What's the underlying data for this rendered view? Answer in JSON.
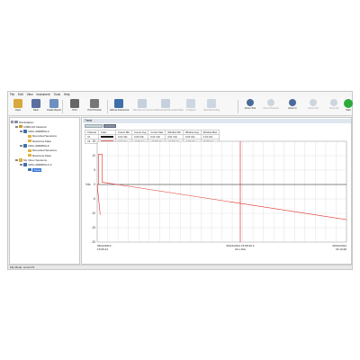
{
  "menu": [
    "File",
    "Edit",
    "View",
    "Instrument",
    "Tools",
    "Help"
  ],
  "toolbar": [
    {
      "label": "Open",
      "icon": "folder-icon",
      "color": "#d9a93b",
      "enabled": true
    },
    {
      "label": "Save",
      "icon": "save-icon",
      "color": "#5a6fa0",
      "enabled": true
    },
    {
      "label": "Create Report",
      "icon": "report-icon",
      "color": "#6e8fbf",
      "enabled": true
    },
    {
      "label": "Print",
      "icon": "print-icon",
      "color": "#666666",
      "enabled": true
    },
    {
      "label": "Print Preview",
      "icon": "print-preview-icon",
      "color": "#777777",
      "enabled": true
    },
    {
      "label": "Add an Instrument",
      "icon": "add-instrument-icon",
      "color": "#3f6fa8",
      "enabled": true
    },
    {
      "label": "Remove an Instrument",
      "icon": "remove-instrument-icon",
      "color": "#8aa0bd",
      "enabled": false
    },
    {
      "label": "Download Recorded Data",
      "icon": "download-icon",
      "color": "#8aa0bd",
      "enabled": false
    },
    {
      "label": "Configure",
      "icon": "configure-icon",
      "color": "#9ab0c8",
      "enabled": false
    },
    {
      "label": "Start Recording",
      "icon": "record-icon",
      "color": "#9ab0c8",
      "enabled": false
    },
    {
      "label": "Zoom Tool",
      "icon": "zoom-tool-icon",
      "color": "#4a6a9a",
      "enabled": true
    },
    {
      "label": "Zoom Previous",
      "icon": "zoom-previous-icon",
      "color": "#9aaac0",
      "enabled": false
    },
    {
      "label": "Zoom In",
      "icon": "zoom-in-icon",
      "color": "#4a6a9a",
      "enabled": true
    },
    {
      "label": "Zoom Out",
      "icon": "zoom-out-icon",
      "color": "#9aaac0",
      "enabled": false
    },
    {
      "label": "Zoom All",
      "icon": "zoom-all-icon",
      "color": "#9aaac0",
      "enabled": false
    },
    {
      "label": "Start",
      "icon": "start-icon",
      "color": "#2eaa3a",
      "enabled": true
    }
  ],
  "tree": [
    {
      "label": "Workstation",
      "level": 0,
      "icon": "computer-icon",
      "color": "#7a8fa8",
      "expander": "-"
    },
    {
      "label": "USB/LAN Network",
      "level": 1,
      "icon": "network-icon",
      "color": "#c49a2e",
      "expander": "-"
    },
    {
      "label": "URG-4028D5A-2",
      "level": 2,
      "icon": "instrument-icon",
      "color": "#3a6fb0",
      "expander": "-"
    },
    {
      "label": "Recorded Sessions",
      "level": 3,
      "icon": "folder-icon",
      "color": "#e0b040",
      "expander": ""
    },
    {
      "label": "Real-time Data",
      "level": 3,
      "icon": "folder-icon",
      "color": "#e0b040",
      "expander": ""
    },
    {
      "label": "URG-4028D5A-F",
      "level": 2,
      "icon": "instrument-icon",
      "color": "#3a6fb0",
      "expander": "-"
    },
    {
      "label": "Recorded Sessions",
      "level": 3,
      "icon": "folder-icon",
      "color": "#e0b040",
      "expander": ""
    },
    {
      "label": "Real-time Data",
      "level": 3,
      "icon": "folder-icon",
      "color": "#e0b040",
      "expander": ""
    },
    {
      "label": "My Open Sessions",
      "level": 1,
      "icon": "folder-icon",
      "color": "#e0b040",
      "expander": "-"
    },
    {
      "label": "URG-4028D5A-F-2",
      "level": 2,
      "icon": "instrument-icon",
      "color": "#3a6fb0",
      "expander": "-"
    },
    {
      "label": "Trend",
      "level": 3,
      "icon": "trend-icon",
      "color": "#3a6fb0",
      "expander": "",
      "selected": true
    }
  ],
  "panel_tab": "Trend",
  "legend": {
    "headers": [
      "Channel",
      "Color",
      "Cursor Min",
      "Cursor Avg",
      "Cursor Max",
      "Window Min",
      "Window Avg",
      "Window Max"
    ],
    "rows": [
      {
        "channel": "V1",
        "color": "#1a1a1a",
        "values": [
          "0.01 Vdc",
          "0.00 Vdc",
          "0.01 Vdc",
          "0.01 Vdc",
          "0.00 Vdc",
          "0.01 Vdc"
        ]
      },
      {
        "channel": "V2",
        "color": "#e0302a",
        "values": [
          "0.01 Vdc",
          "-0.00 Vdc",
          "-12.00 Vdc",
          "-12.00 Vdc",
          "-0.00 Vdc",
          "11.89 Vdc"
        ]
      }
    ]
  },
  "chart_data": {
    "type": "line",
    "ylabel": "Vdc",
    "yticks": [
      15,
      10,
      5,
      0,
      -5,
      -10,
      -15,
      -20
    ],
    "ylim": [
      -20,
      15
    ],
    "grid": true,
    "x_start": {
      "date": "06/12/2014",
      "time": "15:05:31"
    },
    "x_end": {
      "date": "06/12/2014",
      "time": "15:10:48"
    },
    "cursor": {
      "date": "06/12/2014",
      "time": "15:08:20.4",
      "span": "20 s /Div",
      "color": "#e0302a"
    },
    "series": [
      {
        "name": "V1",
        "color": "#1a1a1a",
        "x_frac": [
          0.0,
          1.0
        ],
        "values": [
          0.0,
          0.0
        ]
      },
      {
        "name": "V2",
        "color": "#e0302a",
        "x_frac": [
          0.0,
          0.005,
          0.005,
          0.02,
          0.02,
          1.0
        ],
        "values": [
          0.0,
          0.0,
          10.5,
          10.5,
          0.8,
          -12.2
        ]
      },
      {
        "name": "V2 min",
        "color": "#e0302a",
        "x_frac": [
          0.0,
          0.012
        ],
        "values": [
          0.0,
          -10.5
        ]
      }
    ]
  },
  "status": "File Mode: srsrcs P1"
}
